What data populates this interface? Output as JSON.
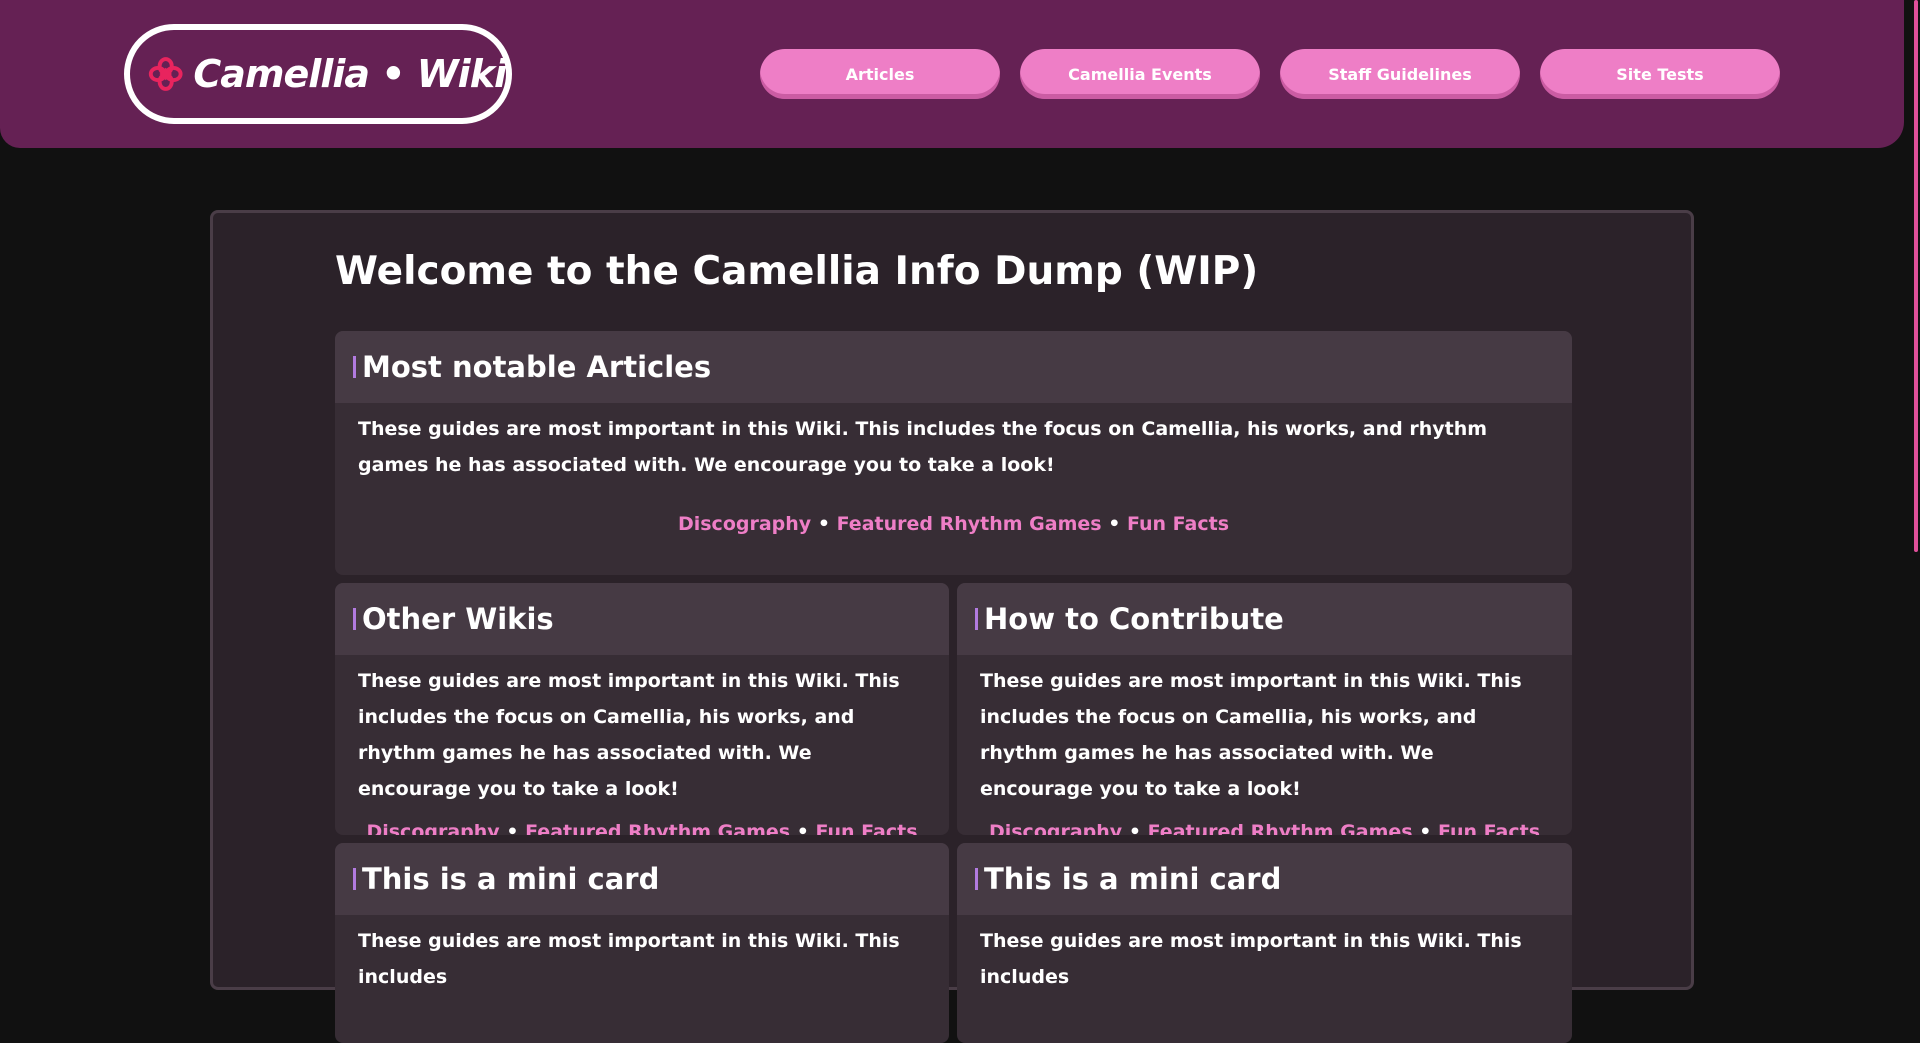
{
  "header": {
    "logo_text": "Camellia • Wiki",
    "logo_icon": "camellia-flower-icon",
    "nav": [
      {
        "label": "Articles"
      },
      {
        "label": "Camellia Events"
      },
      {
        "label": "Staff Guidelines"
      },
      {
        "label": "Site Tests"
      }
    ]
  },
  "main": {
    "title": "Welcome to the Camellia Info Dump (WIP)",
    "cards": {
      "notable": {
        "title": "Most notable Articles",
        "body": "These guides are most important in this Wiki. This includes the focus on Camellia, his works, and rhythm games he has associated with. We encourage you to take a look!",
        "links": [
          "Discography",
          "Featured Rhythm Games",
          "Fun Facts"
        ]
      },
      "other": {
        "title": "Other Wikis",
        "body": "These guides are most important in this Wiki. This includes the focus on Camellia, his works, and rhythm games he has associated with. We encourage you to take a look!",
        "links": [
          "Discography",
          "Featured Rhythm Games",
          "Fun Facts"
        ]
      },
      "contribute": {
        "title": "How to Contribute",
        "body": "These guides are most important in this Wiki. This includes the focus on Camellia, his works, and rhythm games he has associated with. We encourage you to take a look!",
        "links": [
          "Discography",
          "Featured Rhythm Games",
          "Fun Facts"
        ]
      },
      "mini1": {
        "title": "This is a mini card",
        "body": "These guides are most important in this Wiki. This includes"
      },
      "mini2": {
        "title": "This is a mini card",
        "body": "These guides are most important in this Wiki. This includes"
      }
    },
    "separator": "•"
  },
  "colors": {
    "header_bg": "#652154",
    "accent_pink": "#ee7ec6",
    "card_bar": "#b27be0",
    "logo_flower": "#e8245e"
  }
}
